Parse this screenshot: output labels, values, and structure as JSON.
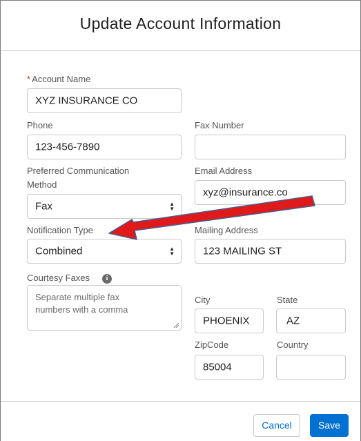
{
  "modal": {
    "title": "Update Account Information"
  },
  "form": {
    "account_name": {
      "label": "Account Name",
      "required_mark": "*",
      "value": "XYZ INSURANCE CO"
    },
    "phone": {
      "label": "Phone",
      "value": "123-456-7890"
    },
    "fax_number": {
      "label": "Fax Number",
      "value": ""
    },
    "preferred_communication": {
      "label_line1": "Preferred Communication",
      "label_line2": "Method",
      "value": "Fax"
    },
    "email": {
      "label": "Email Address",
      "value": "xyz@insurance.co"
    },
    "notification_type": {
      "label": "Notification Type",
      "value": "Combined"
    },
    "mailing_address": {
      "label": "Mailing Address",
      "value": "123 MAILING ST"
    },
    "courtesy_faxes": {
      "label": "Courtesy Faxes",
      "placeholder_line1": "Separate multiple fax",
      "placeholder_line2": "numbers with a comma"
    },
    "city": {
      "label": "City",
      "value": "PHOENIX"
    },
    "state": {
      "label": "State",
      "value": "AZ"
    },
    "zipcode": {
      "label": "ZipCode",
      "value": "85004"
    },
    "country": {
      "label": "Country",
      "value": ""
    }
  },
  "footer": {
    "cancel_label": "Cancel",
    "save_label": "Save"
  },
  "icons": {
    "info": "info-icon",
    "select_arrows": "updown-icon"
  },
  "colors": {
    "accent": "#0070d2",
    "required": "#c23934",
    "annotation_arrow": "#e0191a"
  }
}
